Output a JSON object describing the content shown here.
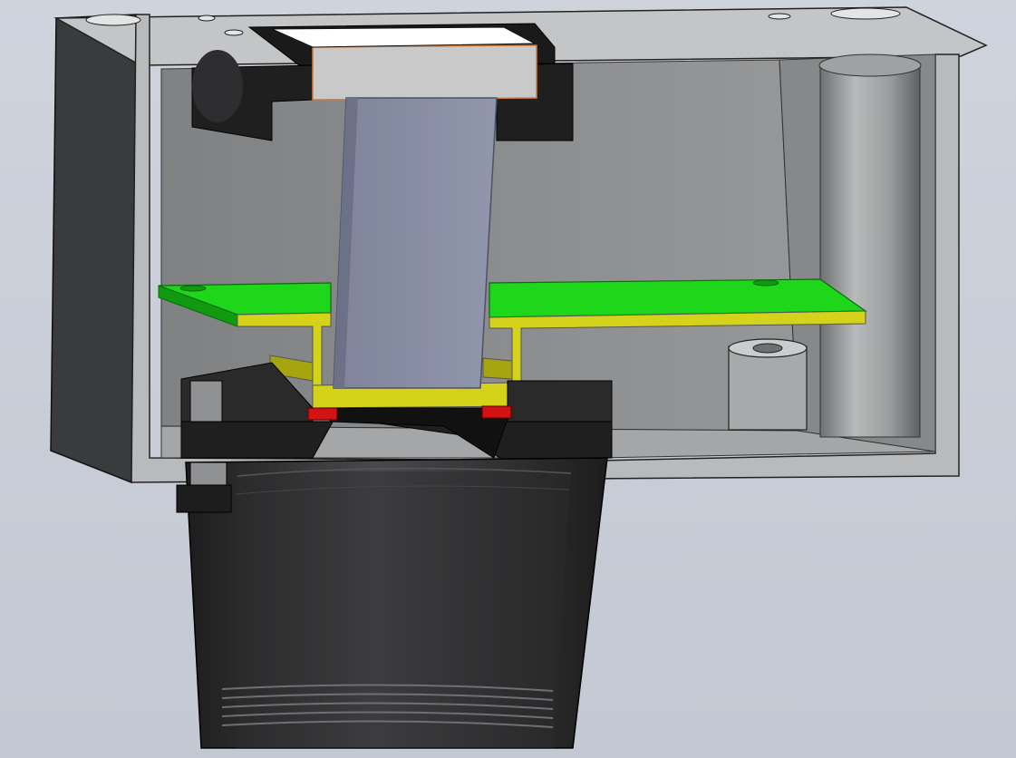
{
  "colors": {
    "background_top": "#cfd3dc",
    "background_bottom": "#c3c8d2",
    "enclosure": "#8f9193",
    "enclosure_light": "#c4c5c6",
    "enclosure_dark": "#6d6f71",
    "enclosure_side": "#3a3b3c",
    "lens_mount": "#2a2a2b",
    "lens_highlight": "#4a4a4c",
    "pcb": "#1ed61a",
    "pcb_edge": "#0f9a10",
    "bracket": "#d4d21a",
    "bracket_dark": "#a6a40f",
    "light_guide": "#8d92a8",
    "light_guide_edge": "#6d7187",
    "diffuser": "#c9c9c9",
    "diffuser_edge": "#d07a3a",
    "seal": "#d41212"
  },
  "icons": {
    "model": "enclosure-cutaway"
  }
}
